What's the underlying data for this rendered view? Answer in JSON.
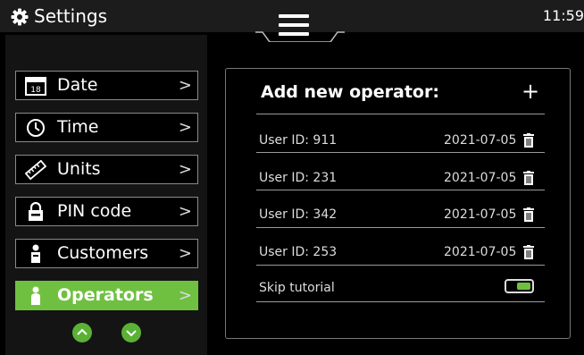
{
  "header": {
    "title": "Settings",
    "clock": "11:59"
  },
  "menu": {
    "items": [
      {
        "label": "Date",
        "icon": "calendar-icon",
        "icon_text": "18"
      },
      {
        "label": "Time",
        "icon": "clock-icon"
      },
      {
        "label": "Units",
        "icon": "ruler-icon"
      },
      {
        "label": "PIN code",
        "icon": "lock-icon"
      },
      {
        "label": "Customers",
        "icon": "person-icon"
      },
      {
        "label": "Operators",
        "icon": "person-icon",
        "selected": true
      }
    ],
    "chevron": ">"
  },
  "operators": {
    "title": "Add new operator:",
    "add_symbol": "+",
    "rows": [
      {
        "user": "User ID: 911",
        "date": "2021-07-05"
      },
      {
        "user": "User ID: 231",
        "date": "2021-07-05"
      },
      {
        "user": "User ID: 342",
        "date": "2021-07-05"
      },
      {
        "user": "User ID: 253",
        "date": "2021-07-05"
      }
    ],
    "skip_tutorial": {
      "label": "Skip tutorial",
      "enabled": true
    }
  },
  "colors": {
    "accent": "#6fc041",
    "background": "#000000",
    "topbar": "#1c1c1c"
  }
}
